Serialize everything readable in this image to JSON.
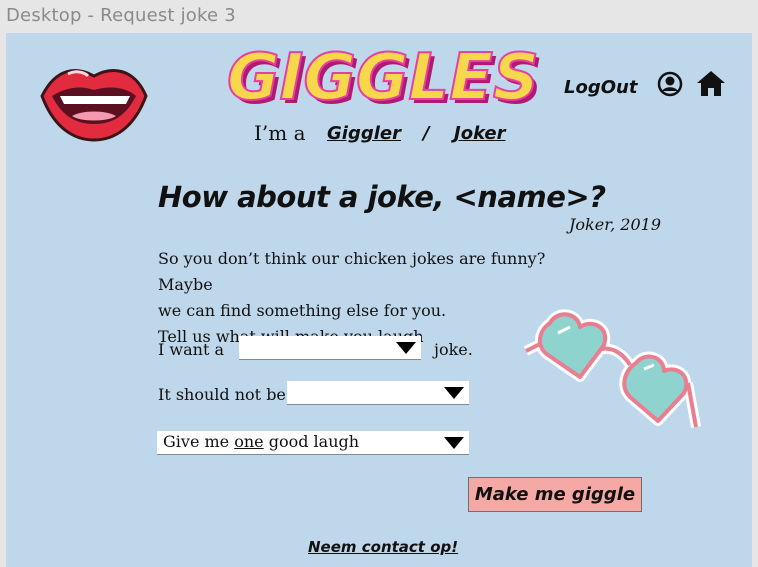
{
  "frame": {
    "title": "Desktop - Request joke 3"
  },
  "header": {
    "logo_text": "GIGGLES",
    "logout_label": "LogOut"
  },
  "role": {
    "prefix": "I’m a",
    "giggler": "Giggler",
    "separator": "/",
    "joker": "Joker"
  },
  "main": {
    "headline": "How about a joke, <name>?",
    "quote_source": "Joker, 2019",
    "intro": [
      "So you don’t think our chicken jokes are funny? Maybe",
      "we can find something else for you.",
      "Tell us what will make you laugh"
    ]
  },
  "form": {
    "want_prefix": "I want a",
    "want_value": "",
    "want_suffix": "joke.",
    "not_label": "It should not be",
    "not_value": "",
    "laugh_parts": [
      "Give me ",
      "one",
      " good laugh"
    ],
    "submit_label": "Make me giggle"
  },
  "footer": {
    "contact_label": "Neem contact op!"
  },
  "colors": {
    "background": "#bfd7eb",
    "logo_yellow": "#f7d84a",
    "logo_pink": "#e83fa3",
    "button": "#f4a9a4"
  }
}
